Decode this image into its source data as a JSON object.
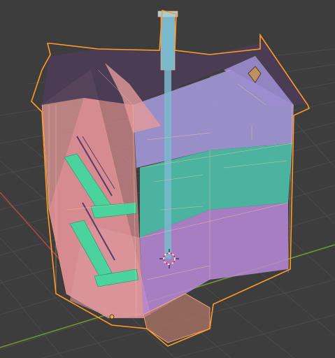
{
  "viewport": {
    "background": "#3d3d3d",
    "grid_color": "#4a4a4a",
    "axis_x_color": "#b3474d",
    "axis_y_color": "#6e9b2e"
  },
  "model": {
    "selection_outline_color": "#ff9a2a",
    "walls_color": "#e59a9a",
    "upper_floor_color": "#a89ee0",
    "middle_floor_color": "#4ec8b0",
    "lower_floor_color": "#b98ad8",
    "stairs_color": "#43d69e",
    "roof_color": "#5a4a6a",
    "chimney_color": "#7ab8cc"
  },
  "gizmo": {
    "icon": "3d-cursor-icon"
  },
  "origin": {
    "icon": "object-origin-dot"
  }
}
